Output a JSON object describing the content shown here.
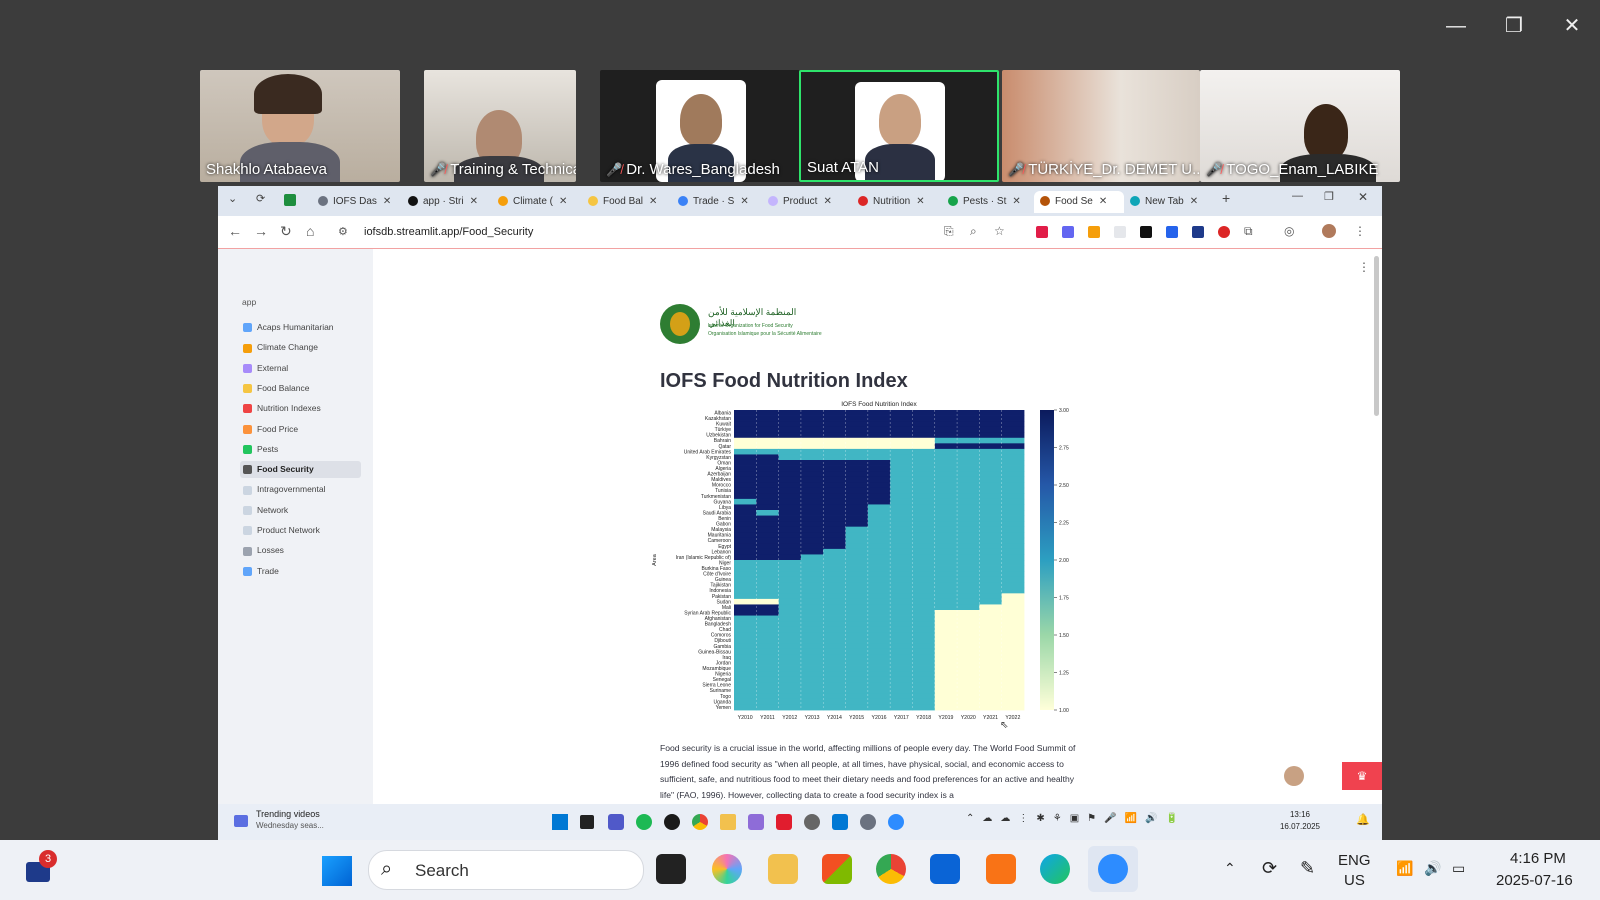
{
  "zoom": {
    "participants": [
      {
        "name": "Shakhlo Atabaeva",
        "muted": false
      },
      {
        "name": "Training & Technical C...",
        "muted": true
      },
      {
        "name": "Dr. Wares_Bangladesh",
        "muted": true
      },
      {
        "name": "Suat ATAN",
        "muted": false,
        "active": true
      },
      {
        "name": "TÜRKİYE_Dr. DEMET U...",
        "muted": true
      },
      {
        "name": "TOGO_Enam_LABIKE",
        "muted": true
      }
    ]
  },
  "browser": {
    "tabs": [
      {
        "label": "IOFS Das",
        "color": "#6b7280"
      },
      {
        "label": "app · Stri",
        "color": "#111111"
      },
      {
        "label": "Climate (",
        "color": "#f59e0b"
      },
      {
        "label": "Food Bal",
        "color": "#f5c542"
      },
      {
        "label": "Trade · S",
        "color": "#3b82f6"
      },
      {
        "label": "Product",
        "color": "#c4b5fd"
      },
      {
        "label": "Nutrition",
        "color": "#dc2626"
      },
      {
        "label": "Pests · St",
        "color": "#16a34a"
      },
      {
        "label": "Food Se",
        "color": "#b45309",
        "active": true
      },
      {
        "label": "New Tab",
        "color": "#0ea5b7"
      }
    ],
    "url": "iofsdb.streamlit.app/Food_Security"
  },
  "sidebar": {
    "heading": "app",
    "items": [
      {
        "label": "Acaps Humanitarian",
        "color": "#60a5fa"
      },
      {
        "label": "Climate Change",
        "color": "#f59e0b"
      },
      {
        "label": "External",
        "color": "#a78bfa"
      },
      {
        "label": "Food Balance",
        "color": "#f5c542"
      },
      {
        "label": "Nutrition Indexes",
        "color": "#ef4444"
      },
      {
        "label": "Food Price",
        "color": "#fb923c"
      },
      {
        "label": "Pests",
        "color": "#22c55e"
      },
      {
        "label": "Food Security",
        "color": "#555555",
        "selected": true
      },
      {
        "label": "Intragovernmental",
        "color": "#cbd5e1"
      },
      {
        "label": "Network",
        "color": "#cbd5e1"
      },
      {
        "label": "Product Network",
        "color": "#cbd5e1"
      },
      {
        "label": "Losses",
        "color": "#9ca3af"
      },
      {
        "label": "Trade",
        "color": "#60a5fa"
      }
    ]
  },
  "page": {
    "logo_arabic": "المنظمة الإسلامية للأمن الغذائي",
    "logo_english": "Islamic Organization for Food Security",
    "logo_french": "Organisation Islamique pour la Sécurité Alimentaire",
    "title": "IOFS Food Nutrition Index",
    "paragraph": "Food security is a crucial issue in the world, affecting millions of people every day. The World Food Summit of 1996 defined food security as \"when all people, at all times, have physical, social, and economic access to sufficient, safe, and nutritious food to meet their dietary needs and food preferences for an active and healthy life\" (FAO, 1996). However, collecting data to create a food security index is a"
  },
  "chart_data": {
    "type": "heatmap",
    "title": "IOFS Food Nutrition Index",
    "ylabel": "Area",
    "x": [
      "Y2010",
      "Y2011",
      "Y2012",
      "Y2013",
      "Y2014",
      "Y2015",
      "Y2016",
      "Y2017",
      "Y2018",
      "Y2019",
      "Y2020",
      "Y2021",
      "Y2022"
    ],
    "y": [
      "Albania",
      "Kazakhstan",
      "Kuwait",
      "Türkiye",
      "Uzbekistan",
      "Bahrain",
      "Qatar",
      "United Arab Emirates",
      "Kyrgyzstan",
      "Oman",
      "Algeria",
      "Azerbaijan",
      "Maldives",
      "Morocco",
      "Tunisia",
      "Turkmenistan",
      "Guyana",
      "Libya",
      "Saudi Arabia",
      "Benin",
      "Gabon",
      "Malaysia",
      "Mauritania",
      "Cameroon",
      "Egypt",
      "Lebanon",
      "Iran (Islamic Republic of)",
      "Niger",
      "Burkina Faso",
      "Côte d'Ivoire",
      "Guinea",
      "Tajikistan",
      "Indonesia",
      "Pakistan",
      "Sudan",
      "Mali",
      "Syrian Arab Republic",
      "Afghanistan",
      "Bangladesh",
      "Chad",
      "Comoros",
      "Djibouti",
      "Gambia",
      "Guinea-Bissau",
      "Iraq",
      "Jordan",
      "Mozambique",
      "Nigeria",
      "Senegal",
      "Sierra Leone",
      "Suriname",
      "Togo",
      "Uganda",
      "Yemen"
    ],
    "first_level2_col": [
      99,
      99,
      99,
      99,
      99,
      9,
      99,
      0,
      2,
      7,
      7,
      7,
      7,
      7,
      7,
      7,
      7,
      6,
      6,
      6,
      6,
      5,
      5,
      5,
      5,
      4,
      3,
      0,
      0,
      0,
      0,
      0,
      0,
      0,
      0,
      2,
      2,
      0,
      0,
      0,
      0,
      0,
      0,
      0,
      0,
      0,
      0,
      0,
      0,
      0,
      0,
      0,
      0,
      0
    ],
    "first_level1_col": [
      99,
      99,
      99,
      99,
      99,
      99,
      99,
      99,
      99,
      99,
      99,
      99,
      99,
      99,
      99,
      99,
      99,
      99,
      99,
      99,
      99,
      99,
      99,
      99,
      99,
      99,
      99,
      99,
      99,
      99,
      99,
      99,
      99,
      12,
      12,
      11,
      9,
      9,
      9,
      9,
      9,
      9,
      9,
      9,
      9,
      9,
      9,
      9,
      9,
      9,
      9,
      9,
      9,
      9
    ],
    "level1_blocks": [
      {
        "rows": [
          5,
          6
        ],
        "cols": [
          0,
          8
        ]
      },
      {
        "rows": [
          34,
          34
        ],
        "cols": [
          0,
          1
        ]
      }
    ],
    "level2_spots": [
      {
        "row": 7,
        "cols": [
          0,
          0
        ]
      },
      {
        "row": 16,
        "cols": [
          0,
          0
        ]
      },
      {
        "row": 17,
        "cols": [
          7,
          7
        ]
      },
      {
        "row": 18,
        "cols": [
          1,
          1
        ]
      }
    ],
    "colorbar": {
      "min": 1.0,
      "max": 3.0,
      "ticks": [
        "3.00",
        "2.75",
        "2.50",
        "2.25",
        "2.00",
        "1.75",
        "1.50",
        "1.25",
        "1.00"
      ]
    },
    "colors": {
      "level3": "#0f1f6b",
      "level2": "#41b6c4",
      "level1": "#ffffd6"
    }
  },
  "inner_taskbar": {
    "news_title": "Trending videos",
    "news_sub": "Wednesday seas...",
    "time": "13:16",
    "date": "16.07.2025"
  },
  "taskbar": {
    "search_placeholder": "Search",
    "badge": "3",
    "lang1": "ENG",
    "lang2": "US",
    "time": "4:16 PM",
    "date": "2025-07-16"
  }
}
